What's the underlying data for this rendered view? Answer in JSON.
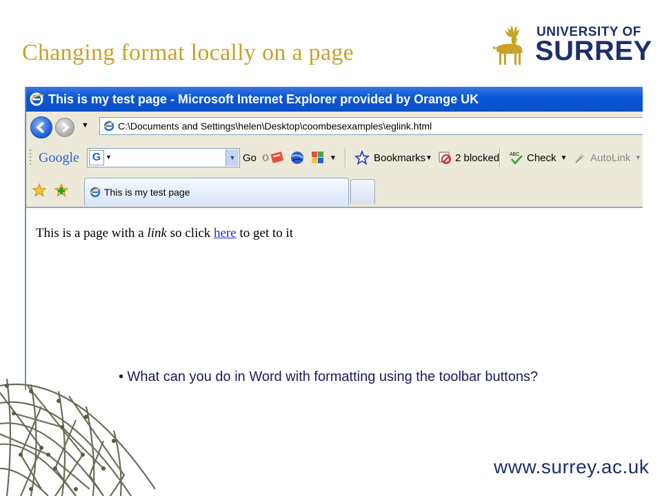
{
  "slide": {
    "title": "Changing format locally on a page",
    "bullet": "• What can you do in Word with formatting using the toolbar buttons?",
    "footer_url": "www.surrey.ac.uk",
    "title_color": "#c9a227",
    "brand_color": "#1c2f6e"
  },
  "logo": {
    "line1": "UNIVERSITY OF",
    "line2": "SURREY",
    "icon": "stag-icon"
  },
  "browser": {
    "window_title": "This is my test page - Microsoft Internet Explorer provided by Orange UK",
    "address": "C:\\Documents and Settings\\helen\\Desktop\\coombesexamples\\eglink.html",
    "toolbar": {
      "google_label": "Google",
      "go_label": "Go",
      "bookmarks_label": "Bookmarks",
      "blocked_label": "2 blocked",
      "check_label": "Check",
      "autolink_label": "AutoLink"
    },
    "tab_title": "This is my test page",
    "page": {
      "text_before": "This is a page with a ",
      "italic_word": "link",
      "text_middle": " so click ",
      "link_text": "here",
      "text_after": " to get to it"
    }
  }
}
